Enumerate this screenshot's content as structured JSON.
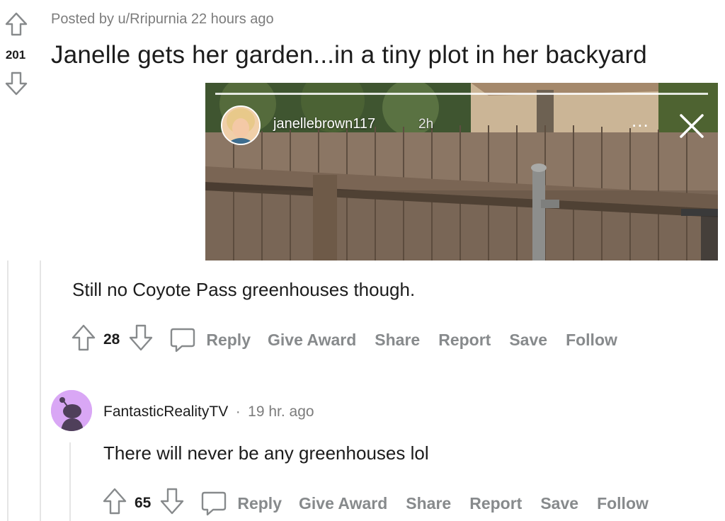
{
  "post": {
    "meta": "Posted by u/Rripurnia 22 hours ago",
    "score": "201",
    "title": "Janelle gets her garden...in a tiny plot in her backyard",
    "story": {
      "username": "janellebrown117",
      "time": "2h",
      "more": "...",
      "close_icon": "close-icon"
    }
  },
  "comments": [
    {
      "text": "Still no Coyote Pass greenhouses though.",
      "score": "28",
      "actions": [
        "Reply",
        "Give Award",
        "Share",
        "Report",
        "Save",
        "Follow"
      ]
    },
    {
      "author": "FantasticRealityTV",
      "separator": "·",
      "time": "19 hr. ago",
      "text": "There will never be any greenhouses lol",
      "score": "65",
      "actions": [
        "Reply",
        "Give Award",
        "Share",
        "Report",
        "Save",
        "Follow"
      ]
    }
  ],
  "colors": {
    "muted": "#7c7c7c",
    "action": "#878a8c",
    "avatar_bg": "#d9a7f5"
  }
}
